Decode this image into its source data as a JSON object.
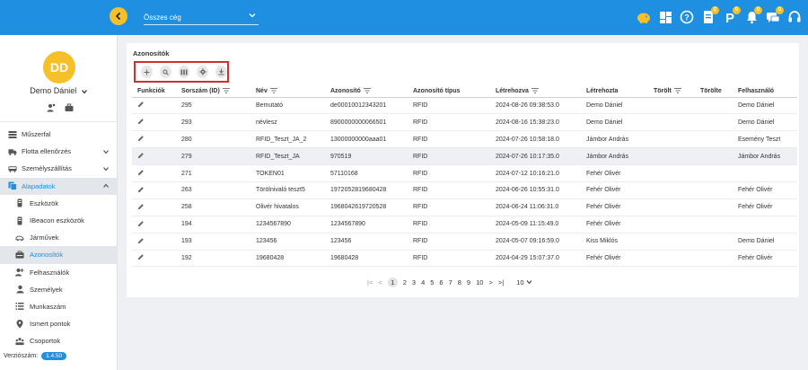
{
  "header": {
    "company_select_value": "Összes cég",
    "badges": {
      "doc": "0",
      "parking": "0",
      "bell": "0",
      "chat": "0"
    }
  },
  "sidebar": {
    "avatar_initials": "DD",
    "user_name": "Demo Dániel",
    "version_label": "Verziószám:",
    "version_value": "1.4.50",
    "items": [
      {
        "label": "Műszerfal",
        "icon": "gauge-icon"
      },
      {
        "label": "Flotta ellenőrzés",
        "icon": "truck-icon"
      },
      {
        "label": "Személyszállítás",
        "icon": "bus-icon"
      },
      {
        "label": "Alapadatok",
        "icon": "data-icon"
      },
      {
        "label": "Eszközök",
        "icon": "device-icon"
      },
      {
        "label": "IBeacon eszközök",
        "icon": "beacon-icon"
      },
      {
        "label": "Járművek",
        "icon": "vehicle-icon"
      },
      {
        "label": "Azonosítók",
        "icon": "id-card-icon"
      },
      {
        "label": "Felhasználók",
        "icon": "user-add-icon"
      },
      {
        "label": "Személyek",
        "icon": "person-icon"
      },
      {
        "label": "Munkaszám",
        "icon": "list-icon"
      },
      {
        "label": "Ismert pontok",
        "icon": "pin-icon"
      },
      {
        "label": "Csoportok",
        "icon": "group-icon"
      }
    ]
  },
  "main": {
    "title": "Azonosítók",
    "toolbar_icons": [
      "plus-icon",
      "search-icon",
      "columns-icon",
      "settings-icon",
      "download-icon"
    ],
    "columns": [
      "Funkciók",
      "Sorszám (ID)",
      "Név",
      "Azonosító",
      "Azonosító típus",
      "Létrehozva",
      "Létrehozta",
      "Törölt",
      "Törölte",
      "Felhasználó"
    ],
    "rows": [
      {
        "id": "295",
        "name": "Bemutató",
        "ident": "de00010012343201",
        "type": "RFID",
        "created": "2024-08-26 09:38:53.0",
        "creator": "Demo Dániel",
        "deleted": "",
        "deleted_by": "",
        "user": "Demo Dániel"
      },
      {
        "id": "293",
        "name": "névlesz",
        "ident": "8900000000066501",
        "type": "RFID",
        "created": "2024-08-16 15:38:23.0",
        "creator": "Demo Dániel",
        "deleted": "",
        "deleted_by": "",
        "user": "Demo Dániel"
      },
      {
        "id": "280",
        "name": "RFID_Teszt_JA_2",
        "ident": "13000000000aaa01",
        "type": "RFID",
        "created": "2024-07-26 10:58:18.0",
        "creator": "Jámbor András",
        "deleted": "",
        "deleted_by": "",
        "user": "Esemény Teszt"
      },
      {
        "id": "279",
        "name": "RFID_Teszt_JA",
        "ident": "970519",
        "type": "RFID",
        "created": "2024-07-26 10:17:35.0",
        "creator": "Jámbor András",
        "deleted": "",
        "deleted_by": "",
        "user": "Jámbor András"
      },
      {
        "id": "271",
        "name": "TOKEN01",
        "ident": "57110168",
        "type": "RFID",
        "created": "2024-07-12 10:16:21.0",
        "creator": "Fehér Olivér",
        "deleted": "",
        "deleted_by": "",
        "user": ""
      },
      {
        "id": "263",
        "name": "Törölnivaló teszt5",
        "ident": "1972052819680428",
        "type": "RFID",
        "created": "2024-06-26 10:55:31.0",
        "creator": "Fehér Olivér",
        "deleted": "",
        "deleted_by": "",
        "user": "Fehér Olivér"
      },
      {
        "id": "258",
        "name": "Olivér hivatalos",
        "ident": "1968042619720528",
        "type": "RFID",
        "created": "2024-06-24 11:06:31.0",
        "creator": "Fehér Olivér",
        "deleted": "",
        "deleted_by": "",
        "user": "Fehér Olivér"
      },
      {
        "id": "194",
        "name": "1234567890",
        "ident": "1234567890",
        "type": "RFID",
        "created": "2024-05-09 11:15:49.0",
        "creator": "Fehér Olivér",
        "deleted": "",
        "deleted_by": "",
        "user": ""
      },
      {
        "id": "193",
        "name": "123456",
        "ident": "123456",
        "type": "RFID",
        "created": "2024-05-07 09:16:59.0",
        "creator": "Kiss Miklós",
        "deleted": "",
        "deleted_by": "",
        "user": "Demo Dániel"
      },
      {
        "id": "192",
        "name": "19680428",
        "ident": "19680428",
        "type": "RFID",
        "created": "2024-04-29 15:07:37.0",
        "creator": "Fehér Olivér",
        "deleted": "",
        "deleted_by": "",
        "user": "Fehér Olivér"
      }
    ],
    "pagination": {
      "pages": [
        "1",
        "2",
        "3",
        "4",
        "5",
        "6",
        "7",
        "8",
        "9",
        "10"
      ],
      "current": "1",
      "page_size": "10"
    }
  },
  "colors": {
    "primary": "#1e8fe1",
    "accent": "#f5c02a",
    "highlight": "#d32f2f"
  }
}
